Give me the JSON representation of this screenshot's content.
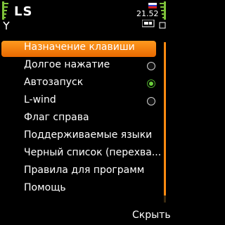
{
  "status": {
    "app_title": "LS",
    "time": "21.52"
  },
  "menu": {
    "items": [
      {
        "label": "Назначение клавиши",
        "selected": true
      },
      {
        "label": "Долгое нажатие",
        "radio": "off"
      },
      {
        "label": "Автозапуск",
        "radio": "on"
      },
      {
        "label": "L-wind",
        "radio": "off"
      },
      {
        "label": "Флаг справа"
      },
      {
        "label": "Поддерживаемые языки"
      },
      {
        "label": "Черный список (перехва..."
      },
      {
        "label": "Правила для программ"
      },
      {
        "label": "Помощь"
      }
    ]
  },
  "softkeys": {
    "right": "Скрыть"
  },
  "colors": {
    "highlight": "#f07a10",
    "radio_on": "#6ccf3c",
    "scrollbar": "#ff8a10"
  }
}
